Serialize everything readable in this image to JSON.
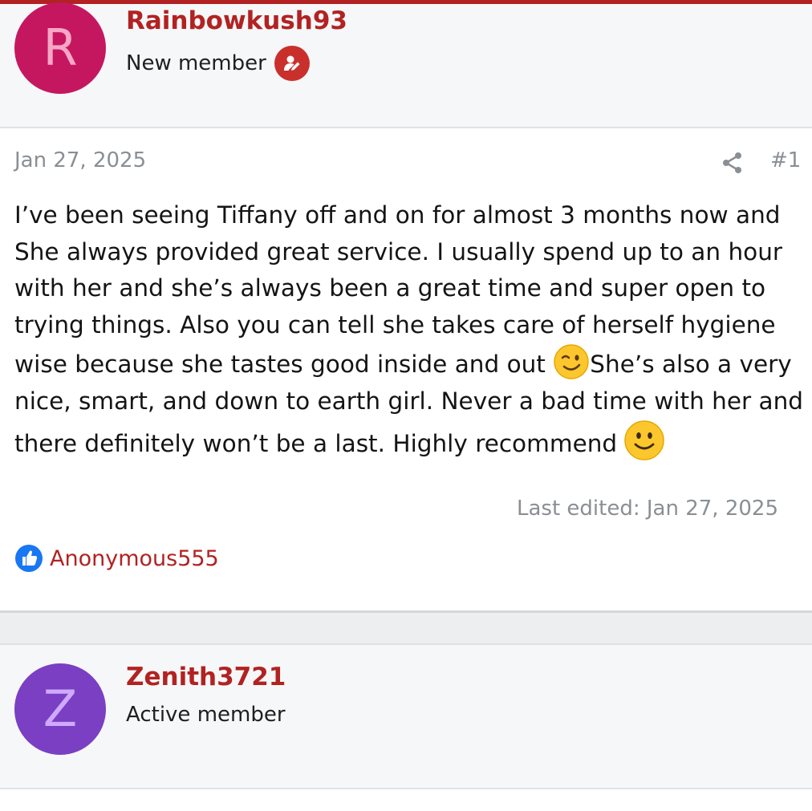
{
  "post": {
    "author": {
      "initial": "R",
      "username": "Rainbowkush93",
      "title": "New member"
    },
    "date": "Jan 27, 2025",
    "number": "#1",
    "message": {
      "part1": "I’ve been seeing Tiffany off and on for almost 3 months now and She always provided great service. I usually spend up to an hour with her and she’s always been a great time and super open to trying things. Also you can tell she takes care of herself hygiene wise because she tastes good inside and out ",
      "part2": "She’s also a very nice, smart, and down to earth girl. Never a bad time with her and there definitely won’t be a last. Highly recommend"
    },
    "last_edited": "Last edited: Jan 27, 2025",
    "reaction": {
      "icon": "thumbs-up-icon",
      "user": "Anonymous555"
    }
  },
  "next_post": {
    "author": {
      "initial": "Z",
      "username": "Zenith3721",
      "title": "Active member"
    }
  },
  "colors": {
    "accent": "#b22222",
    "avatar_r": "#c5175f",
    "avatar_z": "#7a3fc2",
    "like_blue": "#1877f2"
  }
}
